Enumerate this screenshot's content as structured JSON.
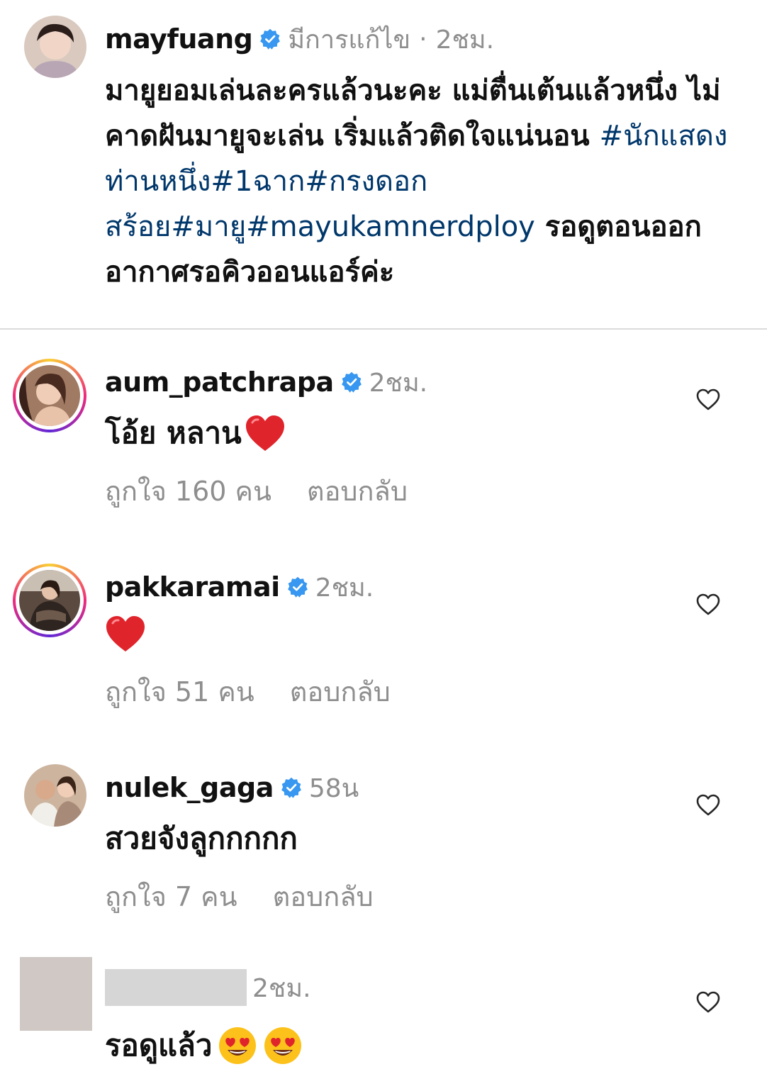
{
  "caption": {
    "username": "mayfuang",
    "edited": "มีการแก้ไข",
    "separator": "·",
    "time": "2ชม.",
    "text_before": "มายูยอมเล่นละครแล้วนะคะ แม่ตื่นเต้นแล้วหนึ่ง ไม่คาดฝันมายูจะเล่น เริ่มแล้วติดใจแน่นอน ",
    "hashtags": "#นักแสดงท่านหนึ่ง#1ฉาก#กรงดอกสร้อย#มายู#mayukamnerdploy",
    "text_after": " รอดูตอนออกอากาศรอคิวออนแอร์ค่ะ"
  },
  "comments": [
    {
      "username": "aum_patchrapa",
      "time": "2ชม.",
      "text": "โอ้ย หลาน",
      "likes": "ถูกใจ 160 คน",
      "reply": "ตอบกลับ"
    },
    {
      "username": "pakkaramai",
      "time": "2ชม.",
      "text": "",
      "likes": "ถูกใจ 51 คน",
      "reply": "ตอบกลับ"
    },
    {
      "username": "nulek_gaga",
      "time": "58น",
      "text": "สวยจังลูกกกกก",
      "likes": "ถูกใจ 7 คน",
      "reply": "ตอบกลับ"
    },
    {
      "username": "",
      "time": "2ชม.",
      "text": "รอดูแล้ว",
      "likes": "",
      "reply": ""
    }
  ],
  "colors": {
    "hashtag": "#00376b",
    "verified": "#3897f0",
    "meta": "#8e8e8e",
    "heart_red": "#e0242c"
  },
  "icons": {
    "verified": "verified-badge-icon",
    "like": "heart-outline-icon",
    "emoji_heart": "red-heart-emoji",
    "emoji_face": "heart-eyes-emoji"
  }
}
